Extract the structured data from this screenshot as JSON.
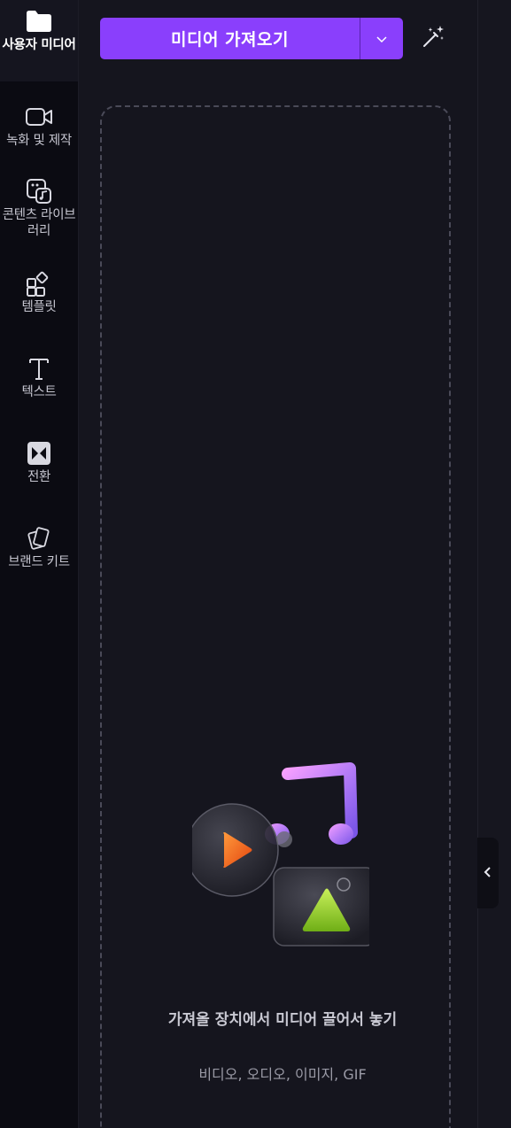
{
  "sidebar": {
    "items": [
      {
        "label": "사용자 미디어",
        "icon": "folder-icon",
        "active": true
      },
      {
        "label": "녹화 및 제작",
        "icon": "video-camera-icon",
        "active": false
      },
      {
        "label": "콘텐츠 라이브러리",
        "icon": "content-library-icon",
        "active": false
      },
      {
        "label": "템플릿",
        "icon": "templates-icon",
        "active": false
      },
      {
        "label": "텍스트",
        "icon": "text-icon",
        "active": false
      },
      {
        "label": "전환",
        "icon": "transition-icon",
        "active": false
      },
      {
        "label": "브랜드 키트",
        "icon": "brand-kit-icon",
        "active": false
      }
    ]
  },
  "toolbar": {
    "import_label": "미디어 가져오기",
    "dropdown_icon": "chevron-down-icon",
    "magic_icon": "magic-wand-icon"
  },
  "dropzone": {
    "title": "가져올 장치에서 미디어 끌어서 놓기",
    "subtitle": "비디오, 오디오, 이미지, GIF"
  },
  "colors": {
    "accent": "#8a3ffc",
    "background": "#15151e",
    "rail": "#0b0b12"
  }
}
